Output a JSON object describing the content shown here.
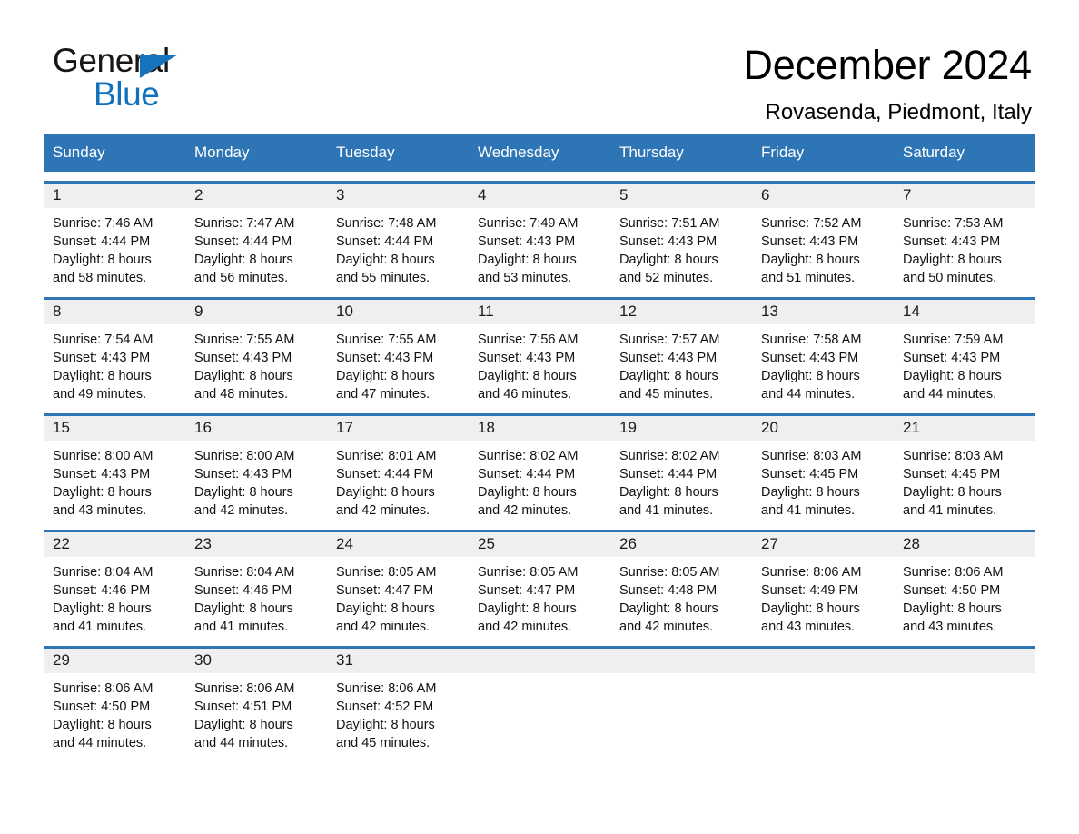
{
  "brand": {
    "name_part1": "General",
    "name_part2": "Blue",
    "triangle_color": "#1574bd",
    "blue_text_color": "#1072bd"
  },
  "header": {
    "month_title": "December 2024",
    "location": "Rovasenda, Piedmont, Italy"
  },
  "theme": {
    "header_blue": "#2e75b6",
    "daynum_band": "#efefef",
    "row_divider": "#2e75b6"
  },
  "weekdays": [
    "Sunday",
    "Monday",
    "Tuesday",
    "Wednesday",
    "Thursday",
    "Friday",
    "Saturday"
  ],
  "weeks": [
    [
      {
        "day": "1",
        "info": "Sunrise: 7:46 AM\nSunset: 4:44 PM\nDaylight: 8 hours\nand 58 minutes."
      },
      {
        "day": "2",
        "info": "Sunrise: 7:47 AM\nSunset: 4:44 PM\nDaylight: 8 hours\nand 56 minutes."
      },
      {
        "day": "3",
        "info": "Sunrise: 7:48 AM\nSunset: 4:44 PM\nDaylight: 8 hours\nand 55 minutes."
      },
      {
        "day": "4",
        "info": "Sunrise: 7:49 AM\nSunset: 4:43 PM\nDaylight: 8 hours\nand 53 minutes."
      },
      {
        "day": "5",
        "info": "Sunrise: 7:51 AM\nSunset: 4:43 PM\nDaylight: 8 hours\nand 52 minutes."
      },
      {
        "day": "6",
        "info": "Sunrise: 7:52 AM\nSunset: 4:43 PM\nDaylight: 8 hours\nand 51 minutes."
      },
      {
        "day": "7",
        "info": "Sunrise: 7:53 AM\nSunset: 4:43 PM\nDaylight: 8 hours\nand 50 minutes."
      }
    ],
    [
      {
        "day": "8",
        "info": "Sunrise: 7:54 AM\nSunset: 4:43 PM\nDaylight: 8 hours\nand 49 minutes."
      },
      {
        "day": "9",
        "info": "Sunrise: 7:55 AM\nSunset: 4:43 PM\nDaylight: 8 hours\nand 48 minutes."
      },
      {
        "day": "10",
        "info": "Sunrise: 7:55 AM\nSunset: 4:43 PM\nDaylight: 8 hours\nand 47 minutes."
      },
      {
        "day": "11",
        "info": "Sunrise: 7:56 AM\nSunset: 4:43 PM\nDaylight: 8 hours\nand 46 minutes."
      },
      {
        "day": "12",
        "info": "Sunrise: 7:57 AM\nSunset: 4:43 PM\nDaylight: 8 hours\nand 45 minutes."
      },
      {
        "day": "13",
        "info": "Sunrise: 7:58 AM\nSunset: 4:43 PM\nDaylight: 8 hours\nand 44 minutes."
      },
      {
        "day": "14",
        "info": "Sunrise: 7:59 AM\nSunset: 4:43 PM\nDaylight: 8 hours\nand 44 minutes."
      }
    ],
    [
      {
        "day": "15",
        "info": "Sunrise: 8:00 AM\nSunset: 4:43 PM\nDaylight: 8 hours\nand 43 minutes."
      },
      {
        "day": "16",
        "info": "Sunrise: 8:00 AM\nSunset: 4:43 PM\nDaylight: 8 hours\nand 42 minutes."
      },
      {
        "day": "17",
        "info": "Sunrise: 8:01 AM\nSunset: 4:44 PM\nDaylight: 8 hours\nand 42 minutes."
      },
      {
        "day": "18",
        "info": "Sunrise: 8:02 AM\nSunset: 4:44 PM\nDaylight: 8 hours\nand 42 minutes."
      },
      {
        "day": "19",
        "info": "Sunrise: 8:02 AM\nSunset: 4:44 PM\nDaylight: 8 hours\nand 41 minutes."
      },
      {
        "day": "20",
        "info": "Sunrise: 8:03 AM\nSunset: 4:45 PM\nDaylight: 8 hours\nand 41 minutes."
      },
      {
        "day": "21",
        "info": "Sunrise: 8:03 AM\nSunset: 4:45 PM\nDaylight: 8 hours\nand 41 minutes."
      }
    ],
    [
      {
        "day": "22",
        "info": "Sunrise: 8:04 AM\nSunset: 4:46 PM\nDaylight: 8 hours\nand 41 minutes."
      },
      {
        "day": "23",
        "info": "Sunrise: 8:04 AM\nSunset: 4:46 PM\nDaylight: 8 hours\nand 41 minutes."
      },
      {
        "day": "24",
        "info": "Sunrise: 8:05 AM\nSunset: 4:47 PM\nDaylight: 8 hours\nand 42 minutes."
      },
      {
        "day": "25",
        "info": "Sunrise: 8:05 AM\nSunset: 4:47 PM\nDaylight: 8 hours\nand 42 minutes."
      },
      {
        "day": "26",
        "info": "Sunrise: 8:05 AM\nSunset: 4:48 PM\nDaylight: 8 hours\nand 42 minutes."
      },
      {
        "day": "27",
        "info": "Sunrise: 8:06 AM\nSunset: 4:49 PM\nDaylight: 8 hours\nand 43 minutes."
      },
      {
        "day": "28",
        "info": "Sunrise: 8:06 AM\nSunset: 4:50 PM\nDaylight: 8 hours\nand 43 minutes."
      }
    ],
    [
      {
        "day": "29",
        "info": "Sunrise: 8:06 AM\nSunset: 4:50 PM\nDaylight: 8 hours\nand 44 minutes."
      },
      {
        "day": "30",
        "info": "Sunrise: 8:06 AM\nSunset: 4:51 PM\nDaylight: 8 hours\nand 44 minutes."
      },
      {
        "day": "31",
        "info": "Sunrise: 8:06 AM\nSunset: 4:52 PM\nDaylight: 8 hours\nand 45 minutes."
      },
      {
        "day": "",
        "info": ""
      },
      {
        "day": "",
        "info": ""
      },
      {
        "day": "",
        "info": ""
      },
      {
        "day": "",
        "info": ""
      }
    ]
  ]
}
